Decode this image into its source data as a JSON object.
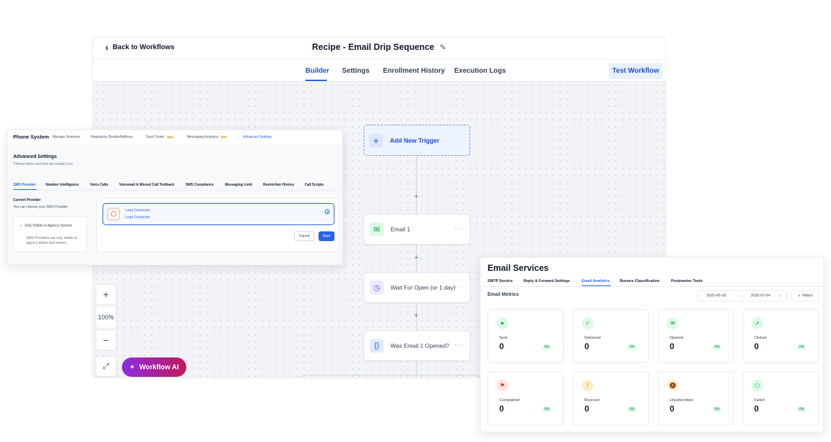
{
  "workflow": {
    "back_label": "Back to Workflows",
    "title": "Recipe - Email Drip Sequence",
    "tabs": [
      "Builder",
      "Settings",
      "Enrollment History",
      "Execution Logs"
    ],
    "active_tab": "Builder",
    "test_button": "Test Workflow",
    "trigger_label": "Add New Trigger",
    "nodes": [
      {
        "label": "Email 1",
        "icon": "email-icon",
        "color": "#079455"
      },
      {
        "label": "Wait For Open (or 1 day)",
        "icon": "clock-icon",
        "color": "#7c3aed"
      },
      {
        "label": "Was Email 1 Opened?",
        "icon": "braces-icon",
        "color": "#2563eb"
      }
    ],
    "zoom_level": "100%",
    "ai_button": "Workflow AI"
  },
  "phone": {
    "title": "Phone System",
    "nav": [
      "Manage Numbers",
      "Regulatory Bundle/Address",
      "Trust Center",
      "Messaging Analytics",
      "Advanced Settings"
    ],
    "new_badge": "New",
    "active_nav": "Advanced Settings",
    "section_title": "Advanced Settings",
    "section_subtitle": "Choose when and how we contact you.",
    "subtabs": [
      "SMS Provider",
      "Number Intelligence",
      "Voice Calls",
      "Voicemail & Missed Call Textback",
      "SMS Compliance",
      "Messaging Limit",
      "Restriction History",
      "Call Scripts"
    ],
    "current_provider_label": "Current Provider",
    "current_provider_sub": "You can choose your SMS Provider",
    "visible_title": "Only Visible to Agency Owners",
    "visible_text": "SMS Providers are only visible to agency admin and owners",
    "provider_name": "Lead Connector",
    "provider_sub": "Lead Connector",
    "cancel": "Cancel",
    "save": "Save"
  },
  "email": {
    "title": "Email Services",
    "tabs": [
      "SMTP Service",
      "Reply & Forward Settings",
      "Email Analytics",
      "Bounce Classification",
      "Postmaster Tools"
    ],
    "active_tab": "Email Analytics",
    "metrics_label": "Email Metrics",
    "date_from": "2025-06-28",
    "date_to": "2025-07-04",
    "filters": "Filters",
    "metrics": [
      {
        "label": "Sent",
        "value": "0",
        "pct": "0%",
        "icon": "send-icon",
        "color": "#079455",
        "bg": "#dcfae6"
      },
      {
        "label": "Delivered",
        "value": "0",
        "pct": "0%",
        "icon": "check-circle-icon",
        "color": "#079455",
        "bg": "#dcfae6"
      },
      {
        "label": "Opened",
        "value": "0",
        "pct": "0%",
        "icon": "mail-open-icon",
        "color": "#079455",
        "bg": "#dcfae6"
      },
      {
        "label": "Clicked",
        "value": "0",
        "pct": "0%",
        "icon": "cursor-click-icon",
        "color": "#079455",
        "bg": "#dcfae6"
      },
      {
        "label": "Complained",
        "value": "0",
        "pct": "0%",
        "icon": "flag-icon",
        "color": "#d92d20",
        "bg": "#fee4e2"
      },
      {
        "label": "Bounced",
        "value": "0",
        "pct": "0%",
        "icon": "message-alert-icon",
        "color": "#dc6803",
        "bg": "#fef0c7"
      },
      {
        "label": "Unsubscribed",
        "value": "0",
        "pct": "0%",
        "icon": "bell-off-icon",
        "color": "#dc6803",
        "bg": "#fef0c7"
      },
      {
        "label": "Failed",
        "value": "0",
        "pct": "0%",
        "icon": "alert-hexagon-icon",
        "color": "#079455",
        "bg": "#dcfae6"
      }
    ]
  }
}
